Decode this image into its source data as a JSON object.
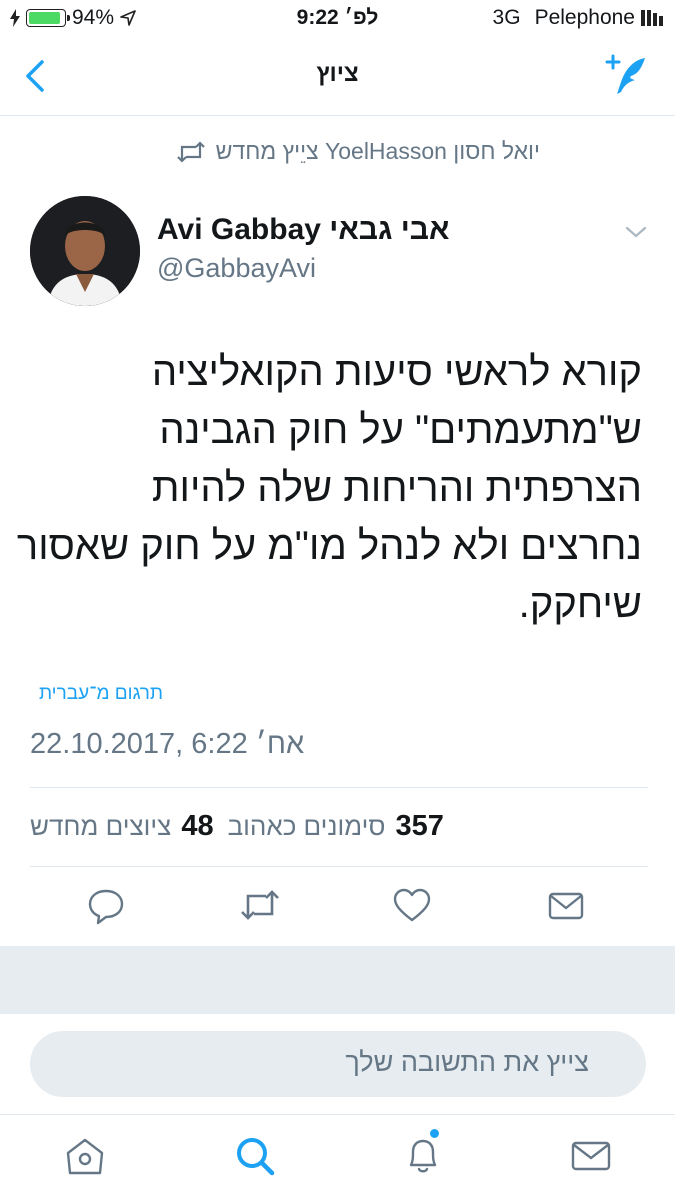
{
  "status_bar": {
    "battery_percent": "94%",
    "battery_level": 0.94,
    "time": "9:22 לפ׳",
    "network": "3G",
    "carrier": "Pelephone"
  },
  "nav": {
    "title": "ציוץ",
    "back_icon": "chevron-left-icon",
    "compose_icon": "compose-tweet-icon"
  },
  "retweet_context": {
    "text": "יואל חסון YoelHasson ציֵיץ מחדש",
    "icon": "retweet-icon"
  },
  "tweet": {
    "display_name": "Avi Gabbay אבי גבאי",
    "handle": "@GabbayAvi",
    "lines": [
      "קורא לראשי סיעות הקואליציה",
      "ש\"מתעמתים\" על חוק הגבינה",
      "הצרפתית והריחות שלה להיות",
      "נחרצים ולא לנהל מו\"מ על חוק שאסור",
      "שיחקק."
    ],
    "translate_link": "תרגום מ־עברית",
    "timestamp": "22.10.2017, 6:22 אח׳",
    "stats": {
      "likes_count": "357",
      "likes_label": "סימונים כאהוב",
      "retweets_count": "48",
      "retweets_label": "ציוצים מחדש"
    }
  },
  "reply": {
    "placeholder": "צייץ את התשובה שלך"
  },
  "colors": {
    "accent": "#1da1f2",
    "secondary_text": "#657786",
    "divider": "#e1e8ed",
    "battery": "#4cd964"
  }
}
